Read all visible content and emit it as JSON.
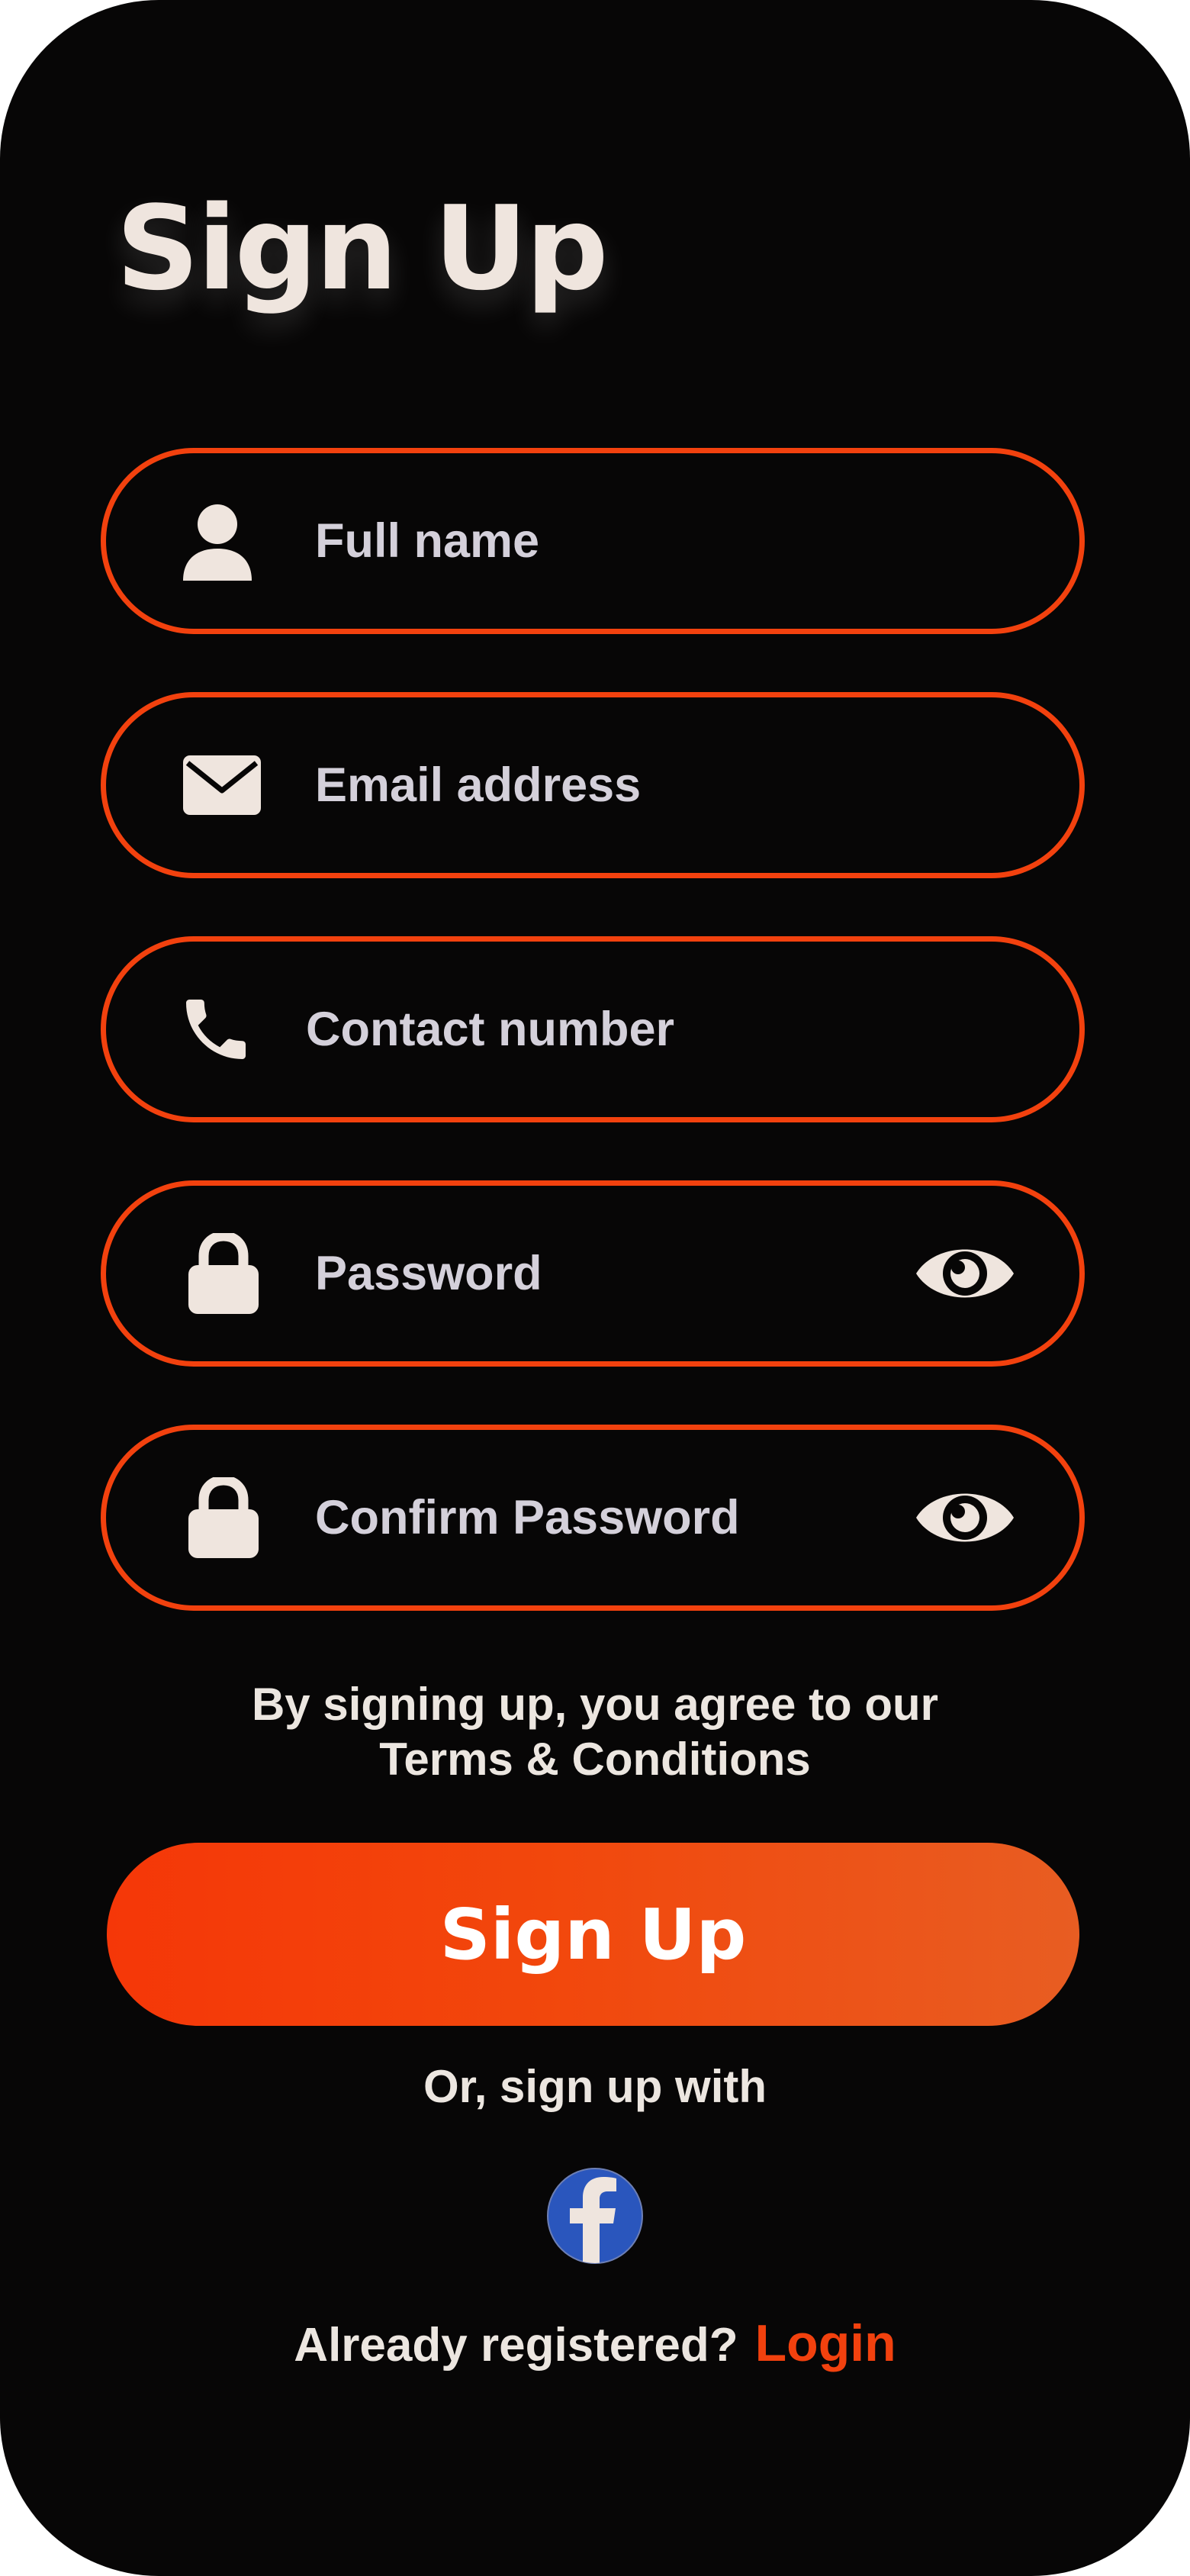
{
  "page_title": "Sign Up",
  "fields": {
    "full_name": {
      "placeholder": "Full name",
      "icon": "user-icon"
    },
    "email": {
      "placeholder": "Email address",
      "icon": "envelope-icon"
    },
    "contact": {
      "placeholder": "Contact number",
      "icon": "phone-icon"
    },
    "password": {
      "placeholder": "Password",
      "icon": "lock-icon",
      "toggle_icon": "eye-icon"
    },
    "confirm_password": {
      "placeholder": "Confirm Password",
      "icon": "lock-icon",
      "toggle_icon": "eye-icon"
    }
  },
  "terms": {
    "line1": "By signing up, you agree to our",
    "line2": "Terms & Conditions"
  },
  "signup_button": {
    "label": "Sign Up"
  },
  "social": {
    "prompt": "Or, sign up with",
    "providers": [
      {
        "name": "facebook",
        "icon": "facebook-icon"
      }
    ]
  },
  "login": {
    "prompt": "Already registered?",
    "link_label": "Login"
  },
  "colors": {
    "background": "#070606",
    "accent": "#f2410e",
    "text_primary": "#efe5de",
    "placeholder": "#d4d0da",
    "facebook": "#2a56bd"
  }
}
